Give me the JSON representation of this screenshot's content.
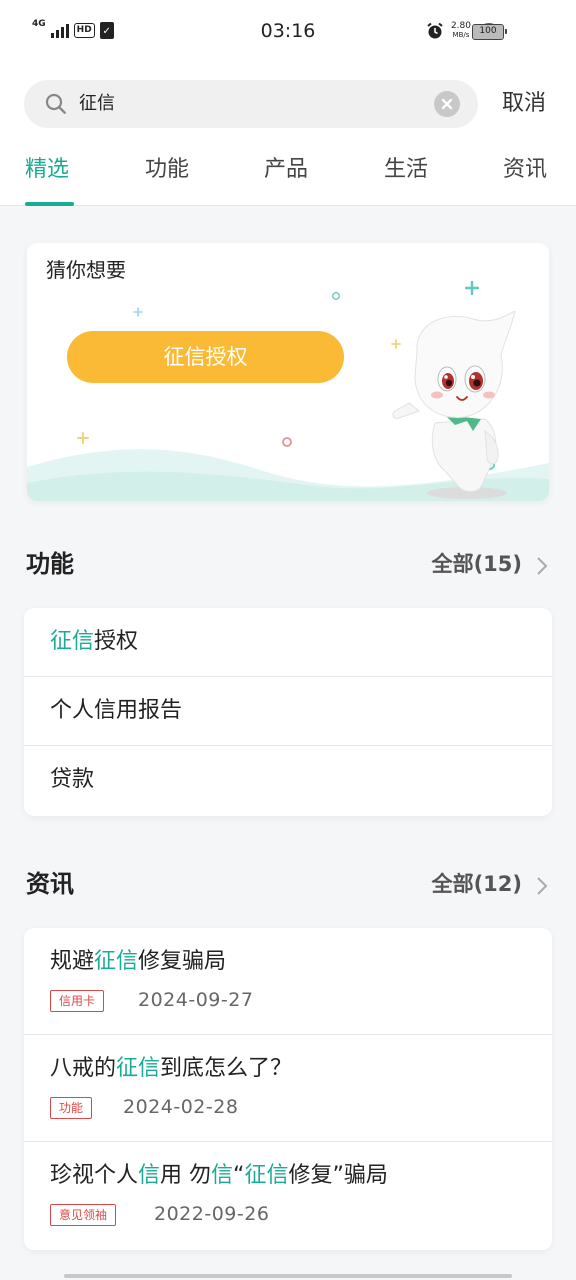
{
  "status_bar": {
    "network": "4G",
    "hd": "HD",
    "time": "03:16",
    "speed_value": "2.80",
    "speed_unit": "MB/s",
    "battery": "100"
  },
  "search": {
    "query": "征信",
    "cancel_label": "取消"
  },
  "tabs": [
    {
      "label": "精选"
    },
    {
      "label": "功能"
    },
    {
      "label": "产品"
    },
    {
      "label": "生活"
    },
    {
      "label": "资讯"
    }
  ],
  "guess": {
    "title": "猜你想要",
    "button_label": "征信授权"
  },
  "functions": {
    "title": "功能",
    "more_label": "全部(15)",
    "items": [
      {
        "highlight": "征信",
        "rest": "授权"
      },
      {
        "highlight": "",
        "rest": "个人信用报告"
      },
      {
        "highlight": "",
        "rest": "贷款"
      }
    ]
  },
  "news": {
    "title": "资讯",
    "more_label": "全部(12)",
    "items": [
      {
        "title_a": "规避",
        "title_hl": "征信",
        "title_b": "修复骗局",
        "tag": "信用卡",
        "date": "2024-09-27"
      },
      {
        "title_a": "八戒的",
        "title_hl": "征信",
        "title_b": "到底怎么了？",
        "tag": "功能",
        "date": "2024-02-28"
      },
      {
        "title_a": "珍视个人",
        "title_hl": "信",
        "title_b": "用 勿",
        "title_hl2": "信",
        "title_c": "“",
        "title_hl3": "征信",
        "title_d": "修复”骗局",
        "tag": "意见领袖",
        "date": "2022-09-26"
      }
    ]
  },
  "colors": {
    "accent": "#1aaa96",
    "button": "#fbba36",
    "tag": "#d84a4a"
  }
}
